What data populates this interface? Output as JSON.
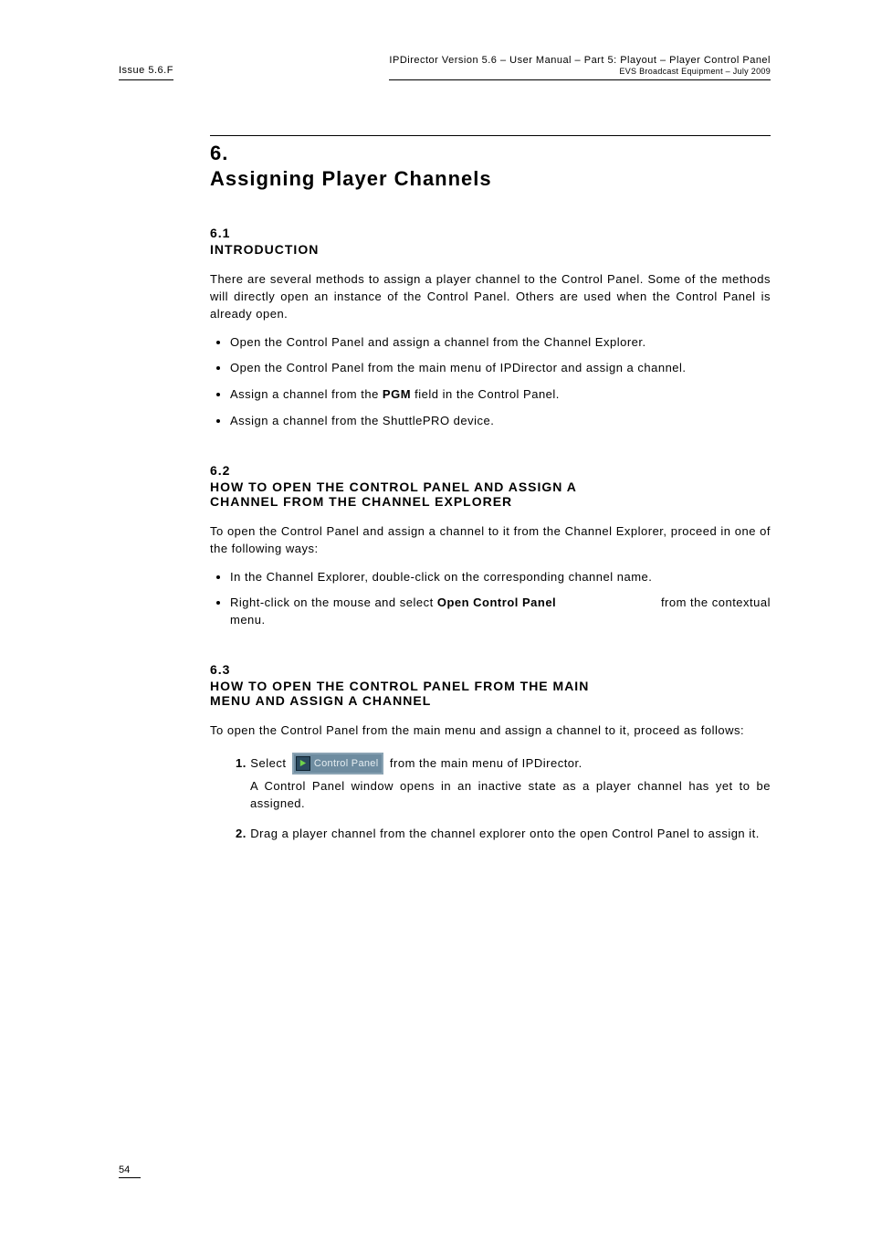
{
  "header": {
    "issue": "Issue 5.6.F",
    "title_line1": "IPDirector Version 5.6 – User Manual – Part 5: Playout – Player Control Panel",
    "title_line2": "EVS Broadcast Equipment – July 2009"
  },
  "section": {
    "number": "6.",
    "title": "Assigning Player Channels",
    "sub1": {
      "number": "6.1",
      "title": "INTRODUCTION",
      "intro": "There are several methods to assign a player channel to the Control Panel. Some of the methods will directly open an instance of the Control Panel. Others are used when the Control Panel is already open.",
      "bullets": [
        "Open the Control Panel and assign a channel from the Channel Explorer.",
        "Open the Control Panel from the main menu of IPDirector and assign a channel.",
        {
          "pre": "Assign a channel from the ",
          "bold": "PGM",
          "post": " field in the Control Panel."
        },
        "Assign a channel from the ShuttlePRO device."
      ]
    },
    "sub2": {
      "number": "6.2",
      "title1": "HOW TO OPEN THE CONTROL PANEL AND ASSIGN A",
      "title2": "CHANNEL FROM THE CHANNEL EXPLORER",
      "intro": "To open the Control Panel and assign a channel to it from the Channel Explorer, proceed in one of the following ways:",
      "bullets": [
        "In the Channel Explorer, double-click on the corresponding channel name.",
        {
          "pre": "Right-click on the mouse and select ",
          "bold": "Open Control Panel",
          "post": " from the contextual",
          "tail": "menu."
        }
      ]
    },
    "sub3": {
      "number": "6.3",
      "title1": "HOW TO OPEN THE CONTROL PANEL FROM THE MAIN",
      "title2": "MENU AND ASSIGN A CHANNEL",
      "intro": "To open the Control Panel from the main menu and assign a channel to it, proceed as follows:",
      "steps": [
        {
          "label": "1.",
          "select_word": "Select",
          "button_label": "Control Panel",
          "after_button": " from the main menu of IPDirector.",
          "note": "A Control Panel window opens in an inactive state as a player channel has yet to be assigned."
        },
        {
          "label": "2.",
          "text": "Drag a player channel from the channel explorer onto the open Control Panel to assign it."
        }
      ]
    }
  },
  "footer": {
    "page": "54"
  }
}
